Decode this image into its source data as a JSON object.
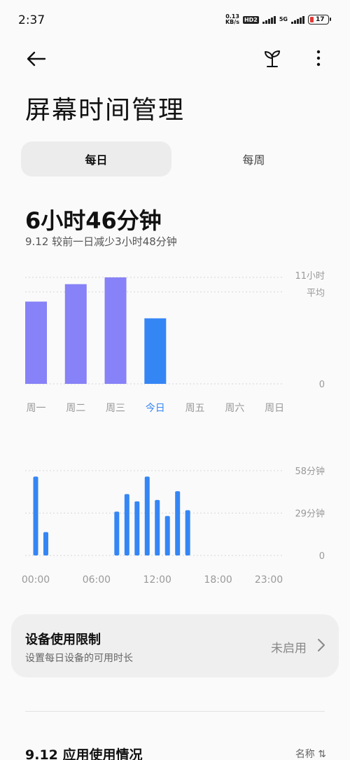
{
  "status_bar": {
    "time": "2:37",
    "speed_value": "0.13",
    "speed_unit": "KB/s",
    "hd_badge": "HD2",
    "network": "5G",
    "battery": "17"
  },
  "header": {
    "title": "屏幕时间管理"
  },
  "tabs": {
    "daily": "每日",
    "weekly": "每周"
  },
  "summary": {
    "total": "6小时46分钟",
    "comparison": "9.12  较前一日减少3小时48分钟"
  },
  "chart_data": [
    {
      "type": "bar",
      "categories": [
        "周一",
        "周二",
        "周三",
        "今日",
        "周五",
        "周六",
        "周日"
      ],
      "values": [
        8.5,
        10.3,
        11.0,
        6.77,
        null,
        null,
        null
      ],
      "ylim": [
        0,
        11
      ],
      "y_labels": {
        "max": "11小时",
        "average": "平均",
        "zero": "0"
      },
      "average": 9.5,
      "colors": {
        "past": "#8782f7",
        "today": "#3586f5",
        "today_label": "#3586f5",
        "label": "#999999"
      }
    },
    {
      "type": "bar",
      "x_tick_labels": [
        "00:00",
        "06:00",
        "12:00",
        "18:00",
        "23:00"
      ],
      "x_tick_hours": [
        0,
        6,
        12,
        18,
        23
      ],
      "x": [
        0,
        1,
        8,
        9,
        10,
        11,
        12,
        13,
        14,
        15
      ],
      "values": [
        54,
        16,
        30,
        42,
        37,
        54,
        38,
        27,
        44,
        31
      ],
      "ylim": [
        0,
        58
      ],
      "y_labels": {
        "max": "58分钟",
        "mid": "29分钟",
        "zero": "0"
      },
      "colors": {
        "bar": "#3586f5"
      }
    }
  ],
  "limit_card": {
    "title": "设备使用限制",
    "subtitle": "设置每日设备的可用时长",
    "status": "未启用"
  },
  "usage_section": {
    "title": "9.12 应用使用情况",
    "sort_label": "名称 ⇅"
  },
  "icons": {
    "back": "arrow-left-icon",
    "sprout": "sprout-icon",
    "more": "more-vertical-icon",
    "chevron": "chevron-right-icon"
  }
}
